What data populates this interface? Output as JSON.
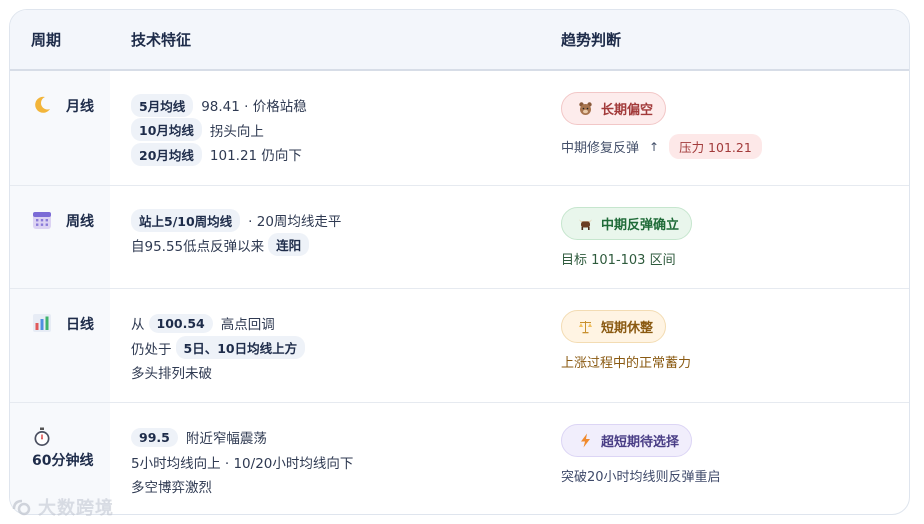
{
  "header": {
    "period": "周期",
    "tech": "技术特征",
    "trend": "趋势判断"
  },
  "rows": [
    {
      "period": "月线",
      "icon": "moon-icon",
      "lines": [
        {
          "pill": "5月均线",
          "text": "98.41 · 价格站稳"
        },
        {
          "pill": "10月均线",
          "text": "拐头向上"
        },
        {
          "pill": "20月均线",
          "text": "101.21 仍向下"
        }
      ],
      "badge": {
        "icon": "bear-icon",
        "label": "长期偏空"
      },
      "sub": {
        "text": "中期修复反弹",
        "arrow": "↑",
        "pill": "压力 101.21"
      }
    },
    {
      "period": "周线",
      "icon": "calendar-icon",
      "lines": [
        {
          "pill": "站上5/10周均线",
          "text": "· 20周均线走平"
        },
        {
          "pre": "自95.55低点反弹以来",
          "pill": "连阳"
        }
      ],
      "badge": {
        "icon": "bull-icon",
        "label": "中期反弹确立"
      },
      "sub": {
        "text": "目标 101-103 区间"
      }
    },
    {
      "period": "日线",
      "icon": "bar-chart-icon",
      "lines": [
        {
          "pre": "从",
          "pill": "100.54",
          "text": "高点回调"
        },
        {
          "pre": "仍处于",
          "pill": "5日、10日均线上方"
        },
        {
          "text": "多头排列未破"
        }
      ],
      "badge": {
        "icon": "balance-icon",
        "label": "短期休整"
      },
      "sub": {
        "text": "上涨过程中的正常蓄力"
      }
    },
    {
      "period": "60分钟线",
      "icon": "stopwatch-icon",
      "lines": [
        {
          "pill": "99.5",
          "text": "附近窄幅震荡"
        },
        {
          "text": "5小时均线向上 · 10/20小时均线向下"
        },
        {
          "text": "多空博弈激烈"
        }
      ],
      "badge": {
        "icon": "lightning-icon",
        "label": "超短期待选择"
      },
      "sub": {
        "text": "突破20小时均线则反弹重启"
      }
    }
  ],
  "watermark": "大数跨境"
}
